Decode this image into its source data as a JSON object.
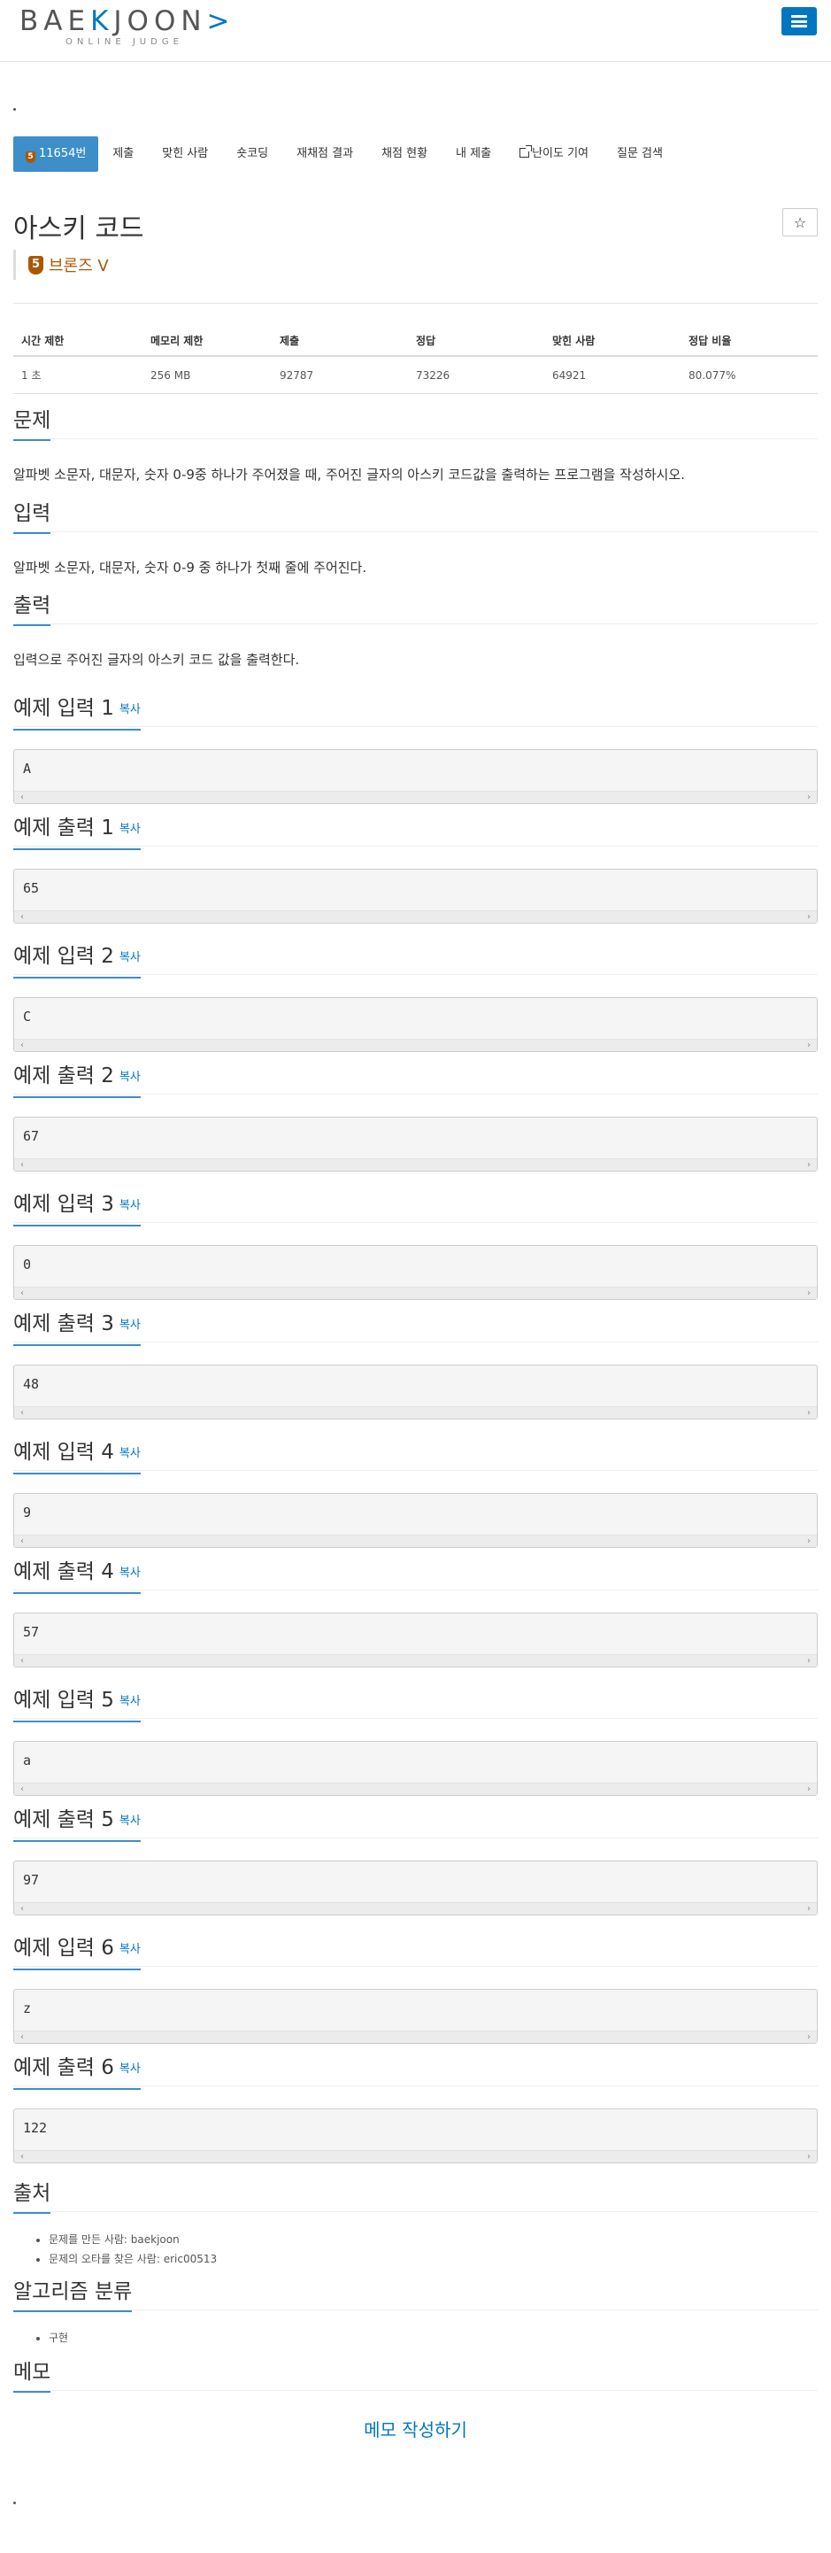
{
  "header": {
    "logo_main_before": "BAE",
    "logo_main_k": "K",
    "logo_main_after": "JOON",
    "logo_arrow": ">",
    "logo_sub": "ONLINE JUDGE",
    "menu_icon": "hamburger-icon"
  },
  "tabs": [
    {
      "label": "11654번",
      "badge": "5"
    },
    {
      "label": "제출"
    },
    {
      "label": "맞힌 사람"
    },
    {
      "label": "숏코딩"
    },
    {
      "label": "재채점 결과"
    },
    {
      "label": "채점 현황"
    },
    {
      "label": "내 제출"
    },
    {
      "label": "난이도 기여",
      "icon": "external-link-icon"
    },
    {
      "label": "질문 검색"
    }
  ],
  "problem": {
    "title": "아스키 코드",
    "star_icon": "☆",
    "tier_badge": "5",
    "tier_name": "브론즈 V"
  },
  "info": {
    "headers": [
      "시간 제한",
      "메모리 제한",
      "제출",
      "정답",
      "맞힌 사람",
      "정답 비율"
    ],
    "values": [
      "1 초",
      "256 MB",
      "92787",
      "73226",
      "64921",
      "80.077%"
    ]
  },
  "sections": {
    "problem_heading": "문제",
    "problem_text": "알파벳 소문자, 대문자, 숫자 0-9중 하나가 주어졌을 때, 주어진 글자의 아스키 코드값을 출력하는 프로그램을 작성하시오.",
    "input_heading": "입력",
    "input_text": "알파벳 소문자, 대문자, 숫자 0-9 중 하나가 첫째 줄에 주어진다.",
    "output_heading": "출력",
    "output_text": "입력으로 주어진 글자의 아스키 코드 값을 출력한다."
  },
  "copy_label": "복사",
  "scroll_left": "‹",
  "scroll_right": "›",
  "samples": [
    {
      "heading": "예제 입력 1",
      "value": "A"
    },
    {
      "heading": "예제 출력 1",
      "value": "65"
    },
    {
      "heading": "예제 입력 2",
      "value": "C"
    },
    {
      "heading": "예제 출력 2",
      "value": "67"
    },
    {
      "heading": "예제 입력 3",
      "value": "0"
    },
    {
      "heading": "예제 출력 3",
      "value": "48"
    },
    {
      "heading": "예제 입력 4",
      "value": "9"
    },
    {
      "heading": "예제 출력 4",
      "value": "57"
    },
    {
      "heading": "예제 입력 5",
      "value": "a"
    },
    {
      "heading": "예제 출력 5",
      "value": "97"
    },
    {
      "heading": "예제 입력 6",
      "value": "z"
    },
    {
      "heading": "예제 출력 6",
      "value": "122"
    }
  ],
  "source": {
    "heading": "출처",
    "items": [
      "문제를 만든 사람: baekjoon",
      "문제의 오타를 찾은 사람: eric00513"
    ]
  },
  "algorithm": {
    "heading": "알고리즘 분류",
    "items": [
      "구현"
    ]
  },
  "memo": {
    "heading": "메모",
    "link": "메모 작성하기"
  },
  "colors": {
    "brand": "#0076c0",
    "tab_active": "#3d8ec9",
    "bronze": "#ad5600"
  }
}
